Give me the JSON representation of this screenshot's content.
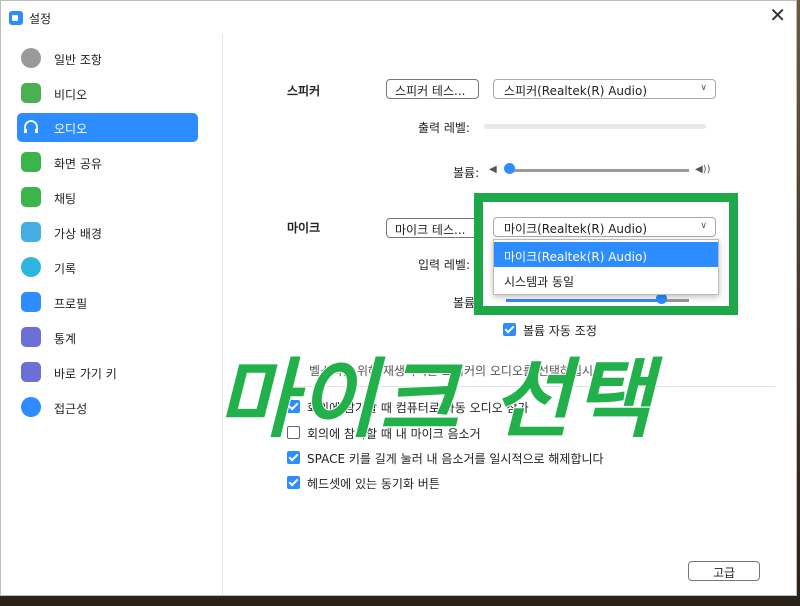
{
  "window": {
    "title": "설정",
    "close": "✕"
  },
  "sidebar": {
    "items": [
      {
        "label": "일반 조항",
        "icon": "gear-icon",
        "color": "#8e8e8e",
        "active": false
      },
      {
        "label": "비디오",
        "icon": "video-icon",
        "color": "#4caf50",
        "active": false
      },
      {
        "label": "오디오",
        "icon": "headphones-icon",
        "color": "#2d8cff",
        "active": true
      },
      {
        "label": "화면 공유",
        "icon": "share-screen-icon",
        "color": "#3bb54a",
        "active": false
      },
      {
        "label": "채팅",
        "icon": "chat-icon",
        "color": "#3bb54a",
        "active": false
      },
      {
        "label": "가상 배경",
        "icon": "person-background-icon",
        "color": "#45aee5",
        "active": false
      },
      {
        "label": "기록",
        "icon": "record-icon",
        "color": "#2db7e0",
        "active": false
      },
      {
        "label": "프로필",
        "icon": "profile-icon",
        "color": "#2d8cff",
        "active": false
      },
      {
        "label": "통계",
        "icon": "statistics-icon",
        "color": "#6b6fd6",
        "active": false
      },
      {
        "label": "바로 가기 키",
        "icon": "keyboard-icon",
        "color": "#6b6fd6",
        "active": false
      },
      {
        "label": "접근성",
        "icon": "accessibility-icon",
        "color": "#2d8cff",
        "active": false
      }
    ]
  },
  "speaker": {
    "label": "스피커",
    "test_button": "스피커 테스...",
    "device": "스피커(Realtek(R) Audio)",
    "output_level_label": "출력 레벨:",
    "volume_label": "볼륨:",
    "volume": 0.0
  },
  "mic": {
    "label": "마이크",
    "test_button": "마이크 테스...",
    "device": "마이크(Realtek(R) Audio)",
    "input_level_label": "입력 레벨:",
    "volume_label": "볼륨:",
    "volume": 0.85,
    "dropdown_options": [
      "마이크(Realtek(R) Audio)",
      "시스템과 동일"
    ],
    "auto_adjust_label": "볼륨 자동 조정",
    "auto_adjust": true
  },
  "hint_text": "벨소리를 위해 재생하려는 스피커의 오디오를 선택하십시오",
  "options": [
    {
      "label": "회의에 참가할 때 컴퓨터로 자동 오디오 참가",
      "checked": true
    },
    {
      "label": "회의에 참가할 때 내 마이크 음소거",
      "checked": false
    },
    {
      "label": "SPACE 키를 길게 눌러 내 음소거를 일시적으로 해제합니다",
      "checked": true
    },
    {
      "label": "헤드셋에 있는 동기화 버튼",
      "checked": true
    }
  ],
  "advanced_button": "고급",
  "overlay_caption": "마이크 선택",
  "colors": {
    "accent": "#2d8cff",
    "highlight": "#1ea84a",
    "caption": "#22b04a"
  }
}
